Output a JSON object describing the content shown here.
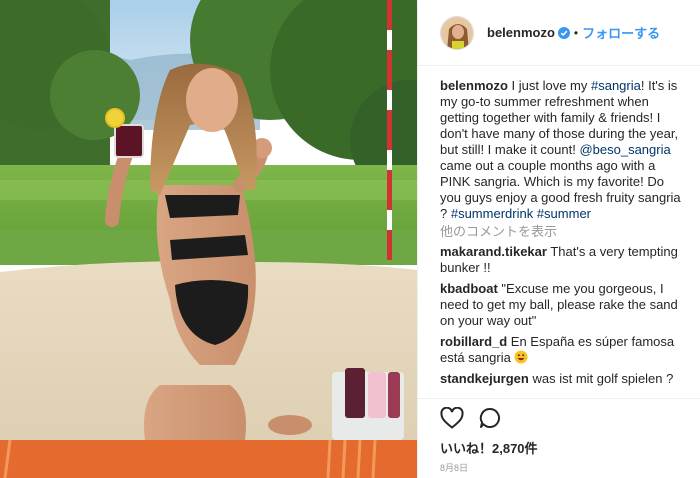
{
  "post": {
    "username": "belenmozo",
    "separator": "•",
    "follow_label": "フォローする"
  },
  "caption": {
    "username": "belenmozo",
    "text_1": " I just love my ",
    "hashtag_1": "#sangria",
    "text_2": "! It's is my go-to summer refreshment when getting together with family & friends! I don't have many of those during the year, but still! I make it count! ",
    "mention": "@beso_sangria",
    "text_3": " came out a couple months ago with a PINK sangria. Which is my favorite! Do you guys enjoy a good fresh fruity sangria ? ",
    "hashtag_2": "#summerdrink",
    "text_4": " ",
    "hashtag_3": "#summer"
  },
  "more_comments_label": "他のコメントを表示",
  "comments": [
    {
      "username": "makarand.tikekar",
      "text": " That's a very tempting bunker !!"
    },
    {
      "username": "kbadboat",
      "text": " \"Excuse me you gorgeous, I need to get my ball, please rake the sand on your way out\""
    },
    {
      "username": "robillard_d",
      "text": " En España es súper famosa está sangria "
    },
    {
      "username": "standkejurgen",
      "text": " was ist mit golf spielen ?"
    }
  ],
  "likes_label": "いいね！2,870件",
  "date_label": "8月8日",
  "icons": {
    "verified": "verified-badge-icon",
    "like": "heart-icon",
    "comment": "comment-bubble-icon",
    "emoji": "grinning-face-icon"
  },
  "colors": {
    "link": "#003569",
    "follow": "#3897f0",
    "muted": "#999999"
  }
}
